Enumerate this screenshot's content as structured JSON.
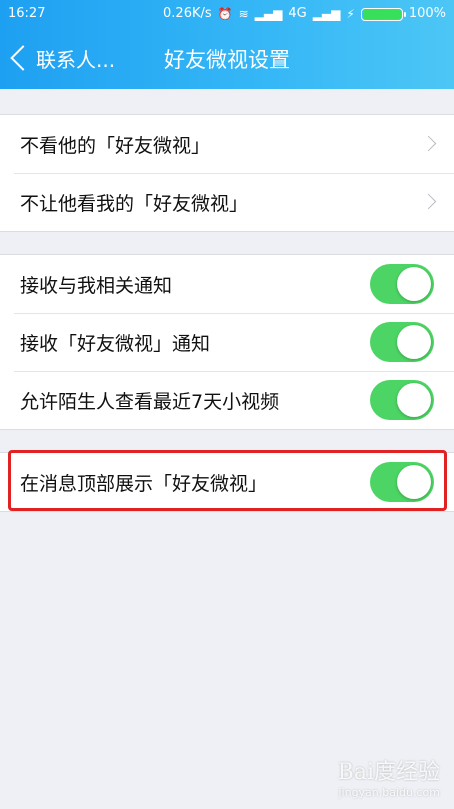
{
  "status_bar": {
    "time": "16:27",
    "speed": "0.26K/s",
    "network": "4G",
    "battery": "100%"
  },
  "nav": {
    "back_label": "联系人...",
    "title": "好友微视设置"
  },
  "group1": [
    {
      "label": "不看他的「好友微视」"
    },
    {
      "label": "不让他看我的「好友微视」"
    }
  ],
  "group2": [
    {
      "label": "接收与我相关通知",
      "on": true
    },
    {
      "label": "接收「好友微视」通知",
      "on": true
    },
    {
      "label": "允许陌生人查看最近7天小视频",
      "on": true
    }
  ],
  "group3": [
    {
      "label": "在消息顶部展示「好友微视」",
      "on": true
    }
  ],
  "colors": {
    "header_start": "#1ea0f2",
    "header_end": "#4cc6f5",
    "toggle_on": "#4cd564",
    "highlight": "#e02222"
  },
  "watermark": {
    "logo": "Bai度经验",
    "url": "jingyan.baidu.com"
  }
}
